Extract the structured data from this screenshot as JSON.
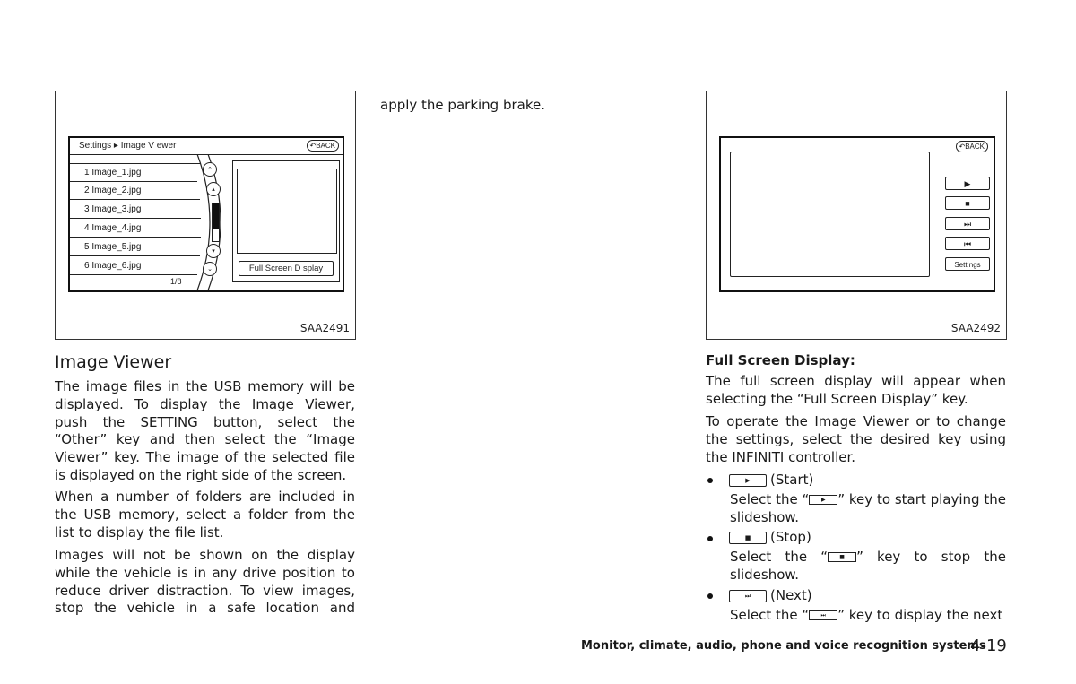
{
  "figure1": {
    "code": "SAA2491",
    "screen": {
      "breadcrumb": "Settings ▸ Image V ewer",
      "back_label": "BACK",
      "files": [
        "1 Image_1.jpg",
        "2 Image_2.jpg",
        "3 Image_3.jpg",
        "4 Image_4.jpg",
        "5 Image_5.jpg",
        "6 Image_6.jpg"
      ],
      "page_indicator": "1/8",
      "full_screen_button": "Full Screen D splay",
      "scroll_icons": {
        "page_up": "⌃",
        "up": "▴",
        "down": "▾",
        "page_down": "⌄"
      }
    }
  },
  "figure2": {
    "code": "SAA2492",
    "screen": {
      "back_label": "BACK",
      "buttons": [
        {
          "name": "play",
          "glyph": "▶"
        },
        {
          "name": "stop",
          "glyph": "■"
        },
        {
          "name": "next",
          "glyph": "⏭"
        },
        {
          "name": "previous",
          "glyph": "⏮"
        },
        {
          "name": "settings",
          "glyph": "Sett ngs"
        }
      ]
    }
  },
  "left_column": {
    "heading": "Image Viewer",
    "paragraphs": [
      "The image files in the USB memory will be displayed. To display the Image Viewer, push the SETTING button, select the “Other” key and then select the “Image Viewer” key. The image of the selected file is displayed on the right side of the screen.",
      "When a number of folders are included in the USB memory, select a folder from the list to display the file list.",
      "Images will not be shown on the display while the vehicle is in any drive position to reduce driver distraction. To view images, stop the vehicle in a safe location and"
    ]
  },
  "middle_column": {
    "text": "apply the parking brake."
  },
  "right_column": {
    "heading": "Full Screen Display:",
    "paragraphs": [
      "The full screen display will appear when selecting the “Full Screen Display” key.",
      "To operate the Image Viewer or to change the settings, select the desired key using the INFINITI controller."
    ],
    "bullets": [
      {
        "glyph": "▶",
        "label": "(Start)",
        "pre": "Select the “",
        "post": "” key to start playing the slideshow."
      },
      {
        "glyph": "■",
        "label": "(Stop)",
        "pre": "Select the “",
        "post": "” key to stop the slideshow."
      },
      {
        "glyph": "⏭",
        "label": "(Next)",
        "pre": "Select the “",
        "post": "” key to display the next"
      }
    ]
  },
  "footer": {
    "section_title": "Monitor, climate, audio, phone and voice recognition systems",
    "page_number": "4-19"
  }
}
